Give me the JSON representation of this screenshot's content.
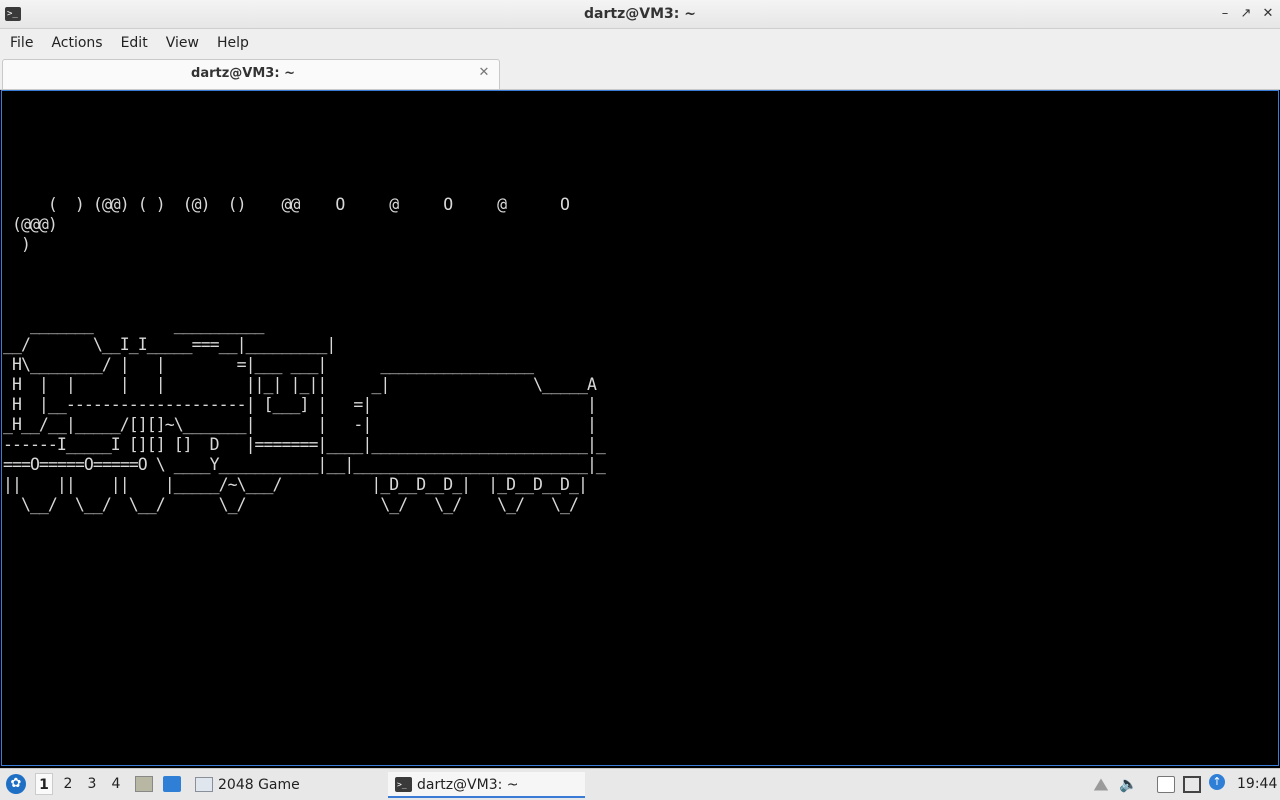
{
  "window": {
    "title": "dartz@VM3: ~",
    "app_icon": "terminal-icon",
    "controls": [
      "minimize-icon",
      "maximize-icon",
      "close-icon"
    ]
  },
  "menubar": {
    "items": [
      "File",
      "Actions",
      "Edit",
      "View",
      "Help"
    ]
  },
  "tabs": [
    {
      "label": "dartz@VM3: ~",
      "active": true
    }
  ],
  "terminal": {
    "lines": [
      "",
      "",
      "",
      "",
      "",
      "     (  ) (@@) ( )  (@)  ()    @@    O     @     O     @      O",
      " (@@@)",
      "  )",
      "",
      "",
      "",
      "   _______         __________",
      "__/       \\__I_I_____===__|_________|",
      " H\\________/ |   |        =|___ ___|      _________________",
      " H  |  |     |   |         ||_| |_||     _|                \\_____A",
      " H  |__--------------------| [___] |   =|                        |",
      "_H__/__|_____/[][]~\\_______|       |   -|                        |",
      "------I_____I [][] []  D   |=======|____|________________________|_",
      "===O=====O=====O \\ ____Y___________|__|__________________________|_",
      "||    ||    ||    |_____/~\\___/          |_D__D__D_|  |_D__D__D_|",
      "  \\__/  \\__/  \\__/      \\_/               \\_/   \\_/    \\_/   \\_/"
    ]
  },
  "taskbar": {
    "start_icon": "lxqt-start-icon",
    "desktops": [
      "1",
      "2",
      "3",
      "4"
    ],
    "active_desktop": "1",
    "quicklaunch": [
      "file-manager-icon",
      "show-desktop-icon"
    ],
    "tasks": [
      {
        "label": "2048 Game",
        "icon": "window-icon",
        "active": false
      },
      {
        "label": "dartz@VM3: ~",
        "icon": "terminal-icon",
        "active": true
      }
    ],
    "tray": [
      "tray-expand-icon",
      "volume-icon",
      "clipboard-icon",
      "network-icon",
      "update-icon"
    ],
    "clock": "19:44"
  },
  "colors": {
    "terminal_bg": "#000000",
    "terminal_fg": "#d8d8d8",
    "accent": "#3a7bd5"
  }
}
